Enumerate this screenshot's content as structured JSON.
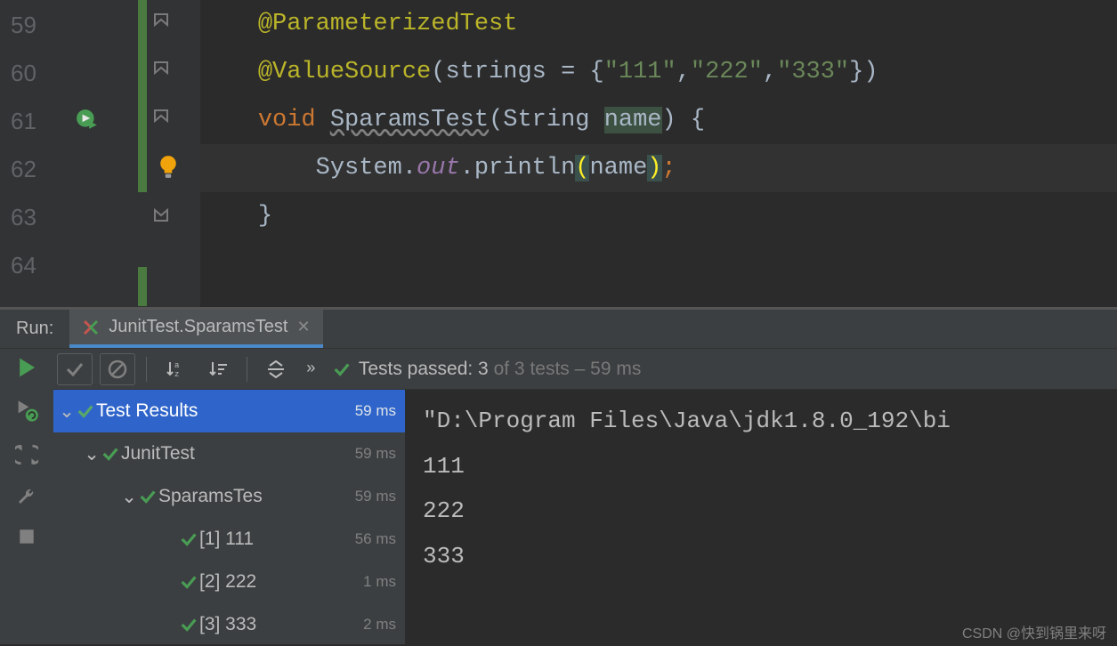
{
  "editor": {
    "lines": {
      "n59": "59",
      "n60": "60",
      "n61": "61",
      "n62": "62",
      "n63": "63",
      "n64": "64"
    },
    "l59_annotation": "@ParameterizedTest",
    "l60_annotation": "@ValueSource",
    "l60_after_anno": "(strings = {",
    "l60_s1": "\"111\"",
    "l60_c1": ",",
    "l60_s2": "\"222\"",
    "l60_c2": ",",
    "l60_s3": "\"333\"",
    "l60_end": "})",
    "l61_kw": "void",
    "l61_space": " ",
    "l61_name": "SparamsTest",
    "l61_params_open": "(String ",
    "l61_param": "name",
    "l61_params_close": ") {",
    "l62_pre": "System.",
    "l62_out": "out",
    "l62_mid": ".println",
    "l62_po": "(",
    "l62_arg": "name",
    "l62_pc": ")",
    "l62_semi": ";",
    "l63_close": "}"
  },
  "run": {
    "label": "Run:",
    "tab": "JunitTest.SparamsTest",
    "summary_prefix": "Tests passed:",
    "summary_count": " 3 ",
    "summary_suffix": "of 3 tests – 59 ms"
  },
  "tree": {
    "root": "Test Results",
    "root_time": "59 ms",
    "n1": "JunitTest",
    "n1_time": "59 ms",
    "n2": "SparamsTes",
    "n2_time": "59 ms",
    "leaf1": "[1] 111",
    "leaf1_time": "56 ms",
    "leaf2": "[2] 222",
    "leaf2_time": "1 ms",
    "leaf3": "[3] 333",
    "leaf3_time": "2 ms"
  },
  "console": {
    "l1": "\"D:\\Program Files\\Java\\jdk1.8.0_192\\bi",
    "l2": "111",
    "l3": "222",
    "l4": "333"
  },
  "watermark": "CSDN @快到锅里来呀"
}
